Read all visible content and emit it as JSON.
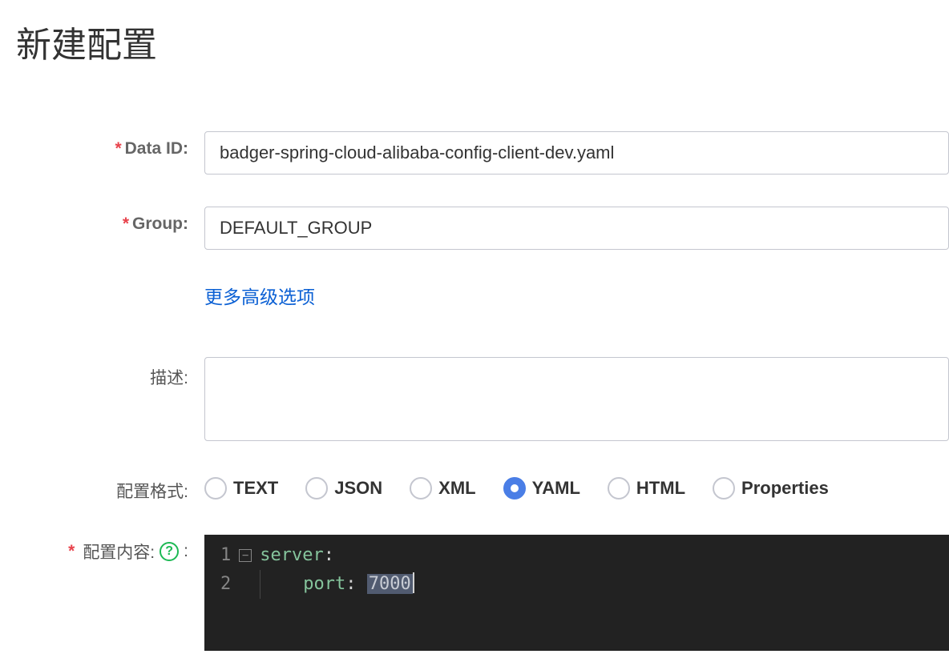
{
  "page": {
    "title": "新建配置"
  },
  "form": {
    "data_id": {
      "label": "Data ID:",
      "value": "badger-spring-cloud-alibaba-config-client-dev.yaml"
    },
    "group": {
      "label": "Group:",
      "value": "DEFAULT_GROUP"
    },
    "advanced_link": "更多高级选项",
    "description": {
      "label": "描述:",
      "value": ""
    },
    "format": {
      "label": "配置格式:",
      "options": [
        {
          "value": "text",
          "label": "TEXT"
        },
        {
          "value": "json",
          "label": "JSON"
        },
        {
          "value": "xml",
          "label": "XML"
        },
        {
          "value": "yaml",
          "label": "YAML"
        },
        {
          "value": "html",
          "label": "HTML"
        },
        {
          "value": "properties",
          "label": "Properties"
        }
      ],
      "selected": "yaml"
    },
    "content": {
      "label": "配置内容:",
      "colon": ":",
      "code": {
        "line1_key": "server",
        "line1_colon": ":",
        "line2_key": "port",
        "line2_colon": ": ",
        "line2_value": "7000",
        "linenums": [
          "1",
          "2"
        ],
        "fold_glyph": "−"
      }
    }
  }
}
